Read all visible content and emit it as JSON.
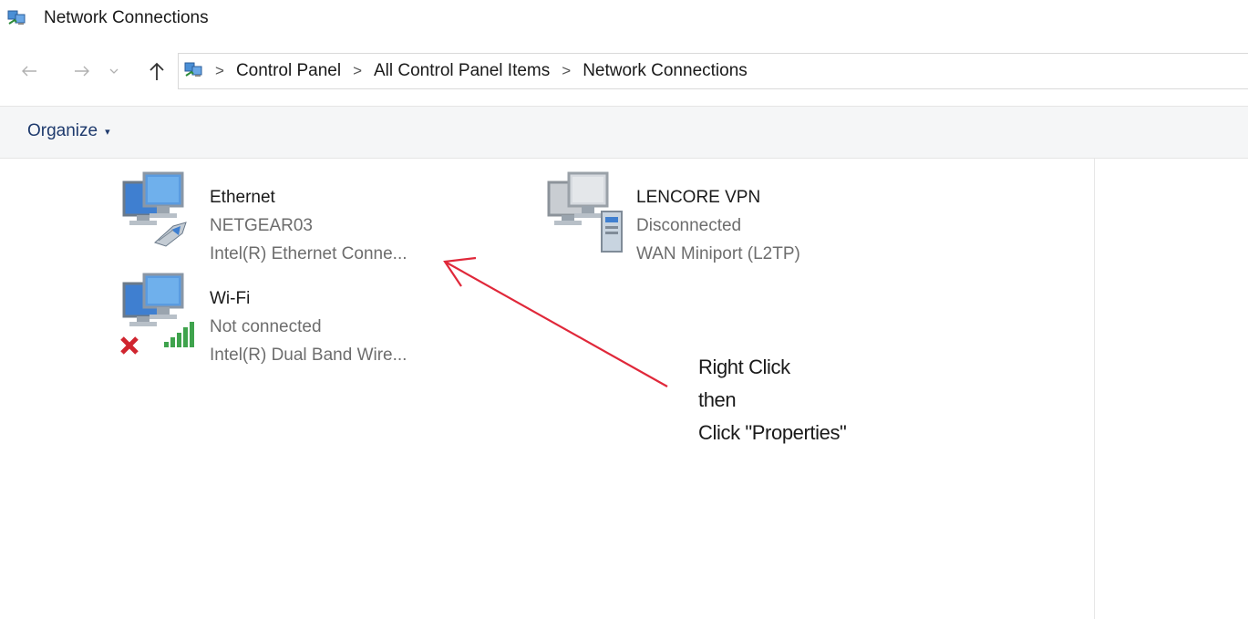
{
  "window": {
    "title": "Network Connections",
    "icon": "network-connections-icon"
  },
  "nav": {
    "back_icon": "arrow-left-icon",
    "forward_icon": "arrow-right-icon",
    "recent_icon": "chevron-down-icon",
    "up_icon": "arrow-up-icon"
  },
  "address": {
    "icon": "network-connections-icon",
    "crumbs": [
      "Control Panel",
      "All Control Panel Items",
      "Network Connections"
    ],
    "separator": ">"
  },
  "toolbar": {
    "organize_label": "Organize",
    "organize_caret": "▾"
  },
  "connections": [
    {
      "name": "Ethernet",
      "status": "NETGEAR03",
      "device": "Intel(R) Ethernet Conne...",
      "icon": "ethernet-adapter-icon"
    },
    {
      "name": "LENCORE VPN",
      "status": "Disconnected",
      "device": "WAN Miniport (L2TP)",
      "icon": "vpn-adapter-icon"
    },
    {
      "name": "Wi-Fi",
      "status": "Not connected",
      "device": "Intel(R) Dual Band Wire...",
      "icon": "wifi-adapter-icon"
    }
  ],
  "annotation": {
    "lines": [
      "Right Click",
      "then",
      "Click \"Properties\""
    ],
    "arrow_color": "#e0283a"
  },
  "colors": {
    "toolbar_bg": "#f5f6f7",
    "organize_text": "#1e3a6d",
    "secondary_text": "#6d6d6d"
  }
}
